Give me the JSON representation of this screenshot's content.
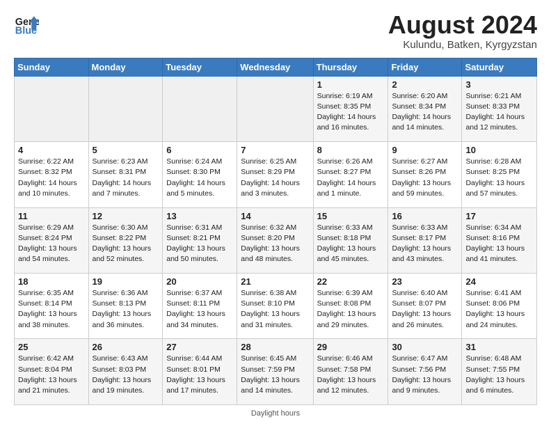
{
  "logo": {
    "line1": "General",
    "line2": "Blue"
  },
  "title": "August 2024",
  "location": "Kulundu, Batken, Kyrgyzstan",
  "header_days": [
    "Sunday",
    "Monday",
    "Tuesday",
    "Wednesday",
    "Thursday",
    "Friday",
    "Saturday"
  ],
  "footer": "Daylight hours",
  "weeks": [
    [
      {
        "day": "",
        "sunrise": "",
        "sunset": "",
        "daylight": ""
      },
      {
        "day": "",
        "sunrise": "",
        "sunset": "",
        "daylight": ""
      },
      {
        "day": "",
        "sunrise": "",
        "sunset": "",
        "daylight": ""
      },
      {
        "day": "",
        "sunrise": "",
        "sunset": "",
        "daylight": ""
      },
      {
        "day": "1",
        "sunrise": "Sunrise: 6:19 AM",
        "sunset": "Sunset: 8:35 PM",
        "daylight": "Daylight: 14 hours and 16 minutes."
      },
      {
        "day": "2",
        "sunrise": "Sunrise: 6:20 AM",
        "sunset": "Sunset: 8:34 PM",
        "daylight": "Daylight: 14 hours and 14 minutes."
      },
      {
        "day": "3",
        "sunrise": "Sunrise: 6:21 AM",
        "sunset": "Sunset: 8:33 PM",
        "daylight": "Daylight: 14 hours and 12 minutes."
      }
    ],
    [
      {
        "day": "4",
        "sunrise": "Sunrise: 6:22 AM",
        "sunset": "Sunset: 8:32 PM",
        "daylight": "Daylight: 14 hours and 10 minutes."
      },
      {
        "day": "5",
        "sunrise": "Sunrise: 6:23 AM",
        "sunset": "Sunset: 8:31 PM",
        "daylight": "Daylight: 14 hours and 7 minutes."
      },
      {
        "day": "6",
        "sunrise": "Sunrise: 6:24 AM",
        "sunset": "Sunset: 8:30 PM",
        "daylight": "Daylight: 14 hours and 5 minutes."
      },
      {
        "day": "7",
        "sunrise": "Sunrise: 6:25 AM",
        "sunset": "Sunset: 8:29 PM",
        "daylight": "Daylight: 14 hours and 3 minutes."
      },
      {
        "day": "8",
        "sunrise": "Sunrise: 6:26 AM",
        "sunset": "Sunset: 8:27 PM",
        "daylight": "Daylight: 14 hours and 1 minute."
      },
      {
        "day": "9",
        "sunrise": "Sunrise: 6:27 AM",
        "sunset": "Sunset: 8:26 PM",
        "daylight": "Daylight: 13 hours and 59 minutes."
      },
      {
        "day": "10",
        "sunrise": "Sunrise: 6:28 AM",
        "sunset": "Sunset: 8:25 PM",
        "daylight": "Daylight: 13 hours and 57 minutes."
      }
    ],
    [
      {
        "day": "11",
        "sunrise": "Sunrise: 6:29 AM",
        "sunset": "Sunset: 8:24 PM",
        "daylight": "Daylight: 13 hours and 54 minutes."
      },
      {
        "day": "12",
        "sunrise": "Sunrise: 6:30 AM",
        "sunset": "Sunset: 8:22 PM",
        "daylight": "Daylight: 13 hours and 52 minutes."
      },
      {
        "day": "13",
        "sunrise": "Sunrise: 6:31 AM",
        "sunset": "Sunset: 8:21 PM",
        "daylight": "Daylight: 13 hours and 50 minutes."
      },
      {
        "day": "14",
        "sunrise": "Sunrise: 6:32 AM",
        "sunset": "Sunset: 8:20 PM",
        "daylight": "Daylight: 13 hours and 48 minutes."
      },
      {
        "day": "15",
        "sunrise": "Sunrise: 6:33 AM",
        "sunset": "Sunset: 8:18 PM",
        "daylight": "Daylight: 13 hours and 45 minutes."
      },
      {
        "day": "16",
        "sunrise": "Sunrise: 6:33 AM",
        "sunset": "Sunset: 8:17 PM",
        "daylight": "Daylight: 13 hours and 43 minutes."
      },
      {
        "day": "17",
        "sunrise": "Sunrise: 6:34 AM",
        "sunset": "Sunset: 8:16 PM",
        "daylight": "Daylight: 13 hours and 41 minutes."
      }
    ],
    [
      {
        "day": "18",
        "sunrise": "Sunrise: 6:35 AM",
        "sunset": "Sunset: 8:14 PM",
        "daylight": "Daylight: 13 hours and 38 minutes."
      },
      {
        "day": "19",
        "sunrise": "Sunrise: 6:36 AM",
        "sunset": "Sunset: 8:13 PM",
        "daylight": "Daylight: 13 hours and 36 minutes."
      },
      {
        "day": "20",
        "sunrise": "Sunrise: 6:37 AM",
        "sunset": "Sunset: 8:11 PM",
        "daylight": "Daylight: 13 hours and 34 minutes."
      },
      {
        "day": "21",
        "sunrise": "Sunrise: 6:38 AM",
        "sunset": "Sunset: 8:10 PM",
        "daylight": "Daylight: 13 hours and 31 minutes."
      },
      {
        "day": "22",
        "sunrise": "Sunrise: 6:39 AM",
        "sunset": "Sunset: 8:08 PM",
        "daylight": "Daylight: 13 hours and 29 minutes."
      },
      {
        "day": "23",
        "sunrise": "Sunrise: 6:40 AM",
        "sunset": "Sunset: 8:07 PM",
        "daylight": "Daylight: 13 hours and 26 minutes."
      },
      {
        "day": "24",
        "sunrise": "Sunrise: 6:41 AM",
        "sunset": "Sunset: 8:06 PM",
        "daylight": "Daylight: 13 hours and 24 minutes."
      }
    ],
    [
      {
        "day": "25",
        "sunrise": "Sunrise: 6:42 AM",
        "sunset": "Sunset: 8:04 PM",
        "daylight": "Daylight: 13 hours and 21 minutes."
      },
      {
        "day": "26",
        "sunrise": "Sunrise: 6:43 AM",
        "sunset": "Sunset: 8:03 PM",
        "daylight": "Daylight: 13 hours and 19 minutes."
      },
      {
        "day": "27",
        "sunrise": "Sunrise: 6:44 AM",
        "sunset": "Sunset: 8:01 PM",
        "daylight": "Daylight: 13 hours and 17 minutes."
      },
      {
        "day": "28",
        "sunrise": "Sunrise: 6:45 AM",
        "sunset": "Sunset: 7:59 PM",
        "daylight": "Daylight: 13 hours and 14 minutes."
      },
      {
        "day": "29",
        "sunrise": "Sunrise: 6:46 AM",
        "sunset": "Sunset: 7:58 PM",
        "daylight": "Daylight: 13 hours and 12 minutes."
      },
      {
        "day": "30",
        "sunrise": "Sunrise: 6:47 AM",
        "sunset": "Sunset: 7:56 PM",
        "daylight": "Daylight: 13 hours and 9 minutes."
      },
      {
        "day": "31",
        "sunrise": "Sunrise: 6:48 AM",
        "sunset": "Sunset: 7:55 PM",
        "daylight": "Daylight: 13 hours and 6 minutes."
      }
    ]
  ]
}
